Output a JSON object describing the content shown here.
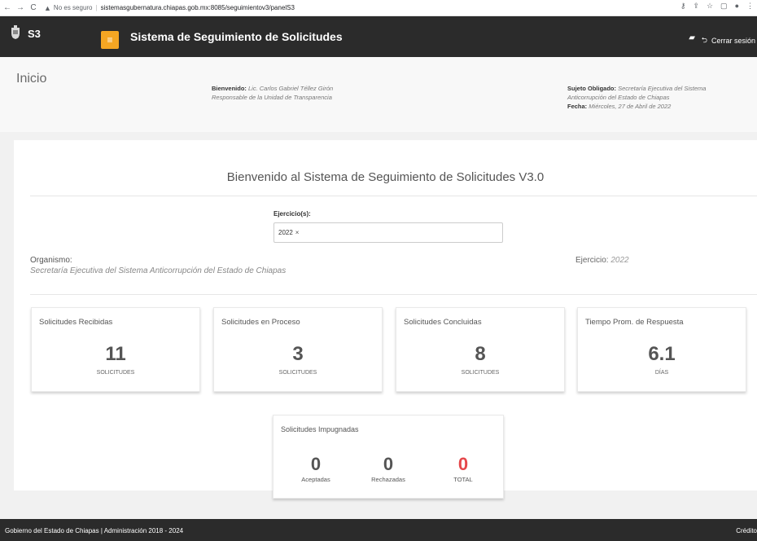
{
  "browser": {
    "back_icon": "←",
    "forward_icon": "→",
    "reload_icon": "C",
    "warning_icon": "▲",
    "security_text": "No es seguro",
    "separator": "|",
    "url": "sistemasgubernatura.chiapas.gob.mx:8085/seguimientov3/panelS3",
    "right_icons": [
      "key-icon",
      "share-icon",
      "star-icon",
      "sidebar-icon",
      "profile-icon",
      "kebab-menu-icon"
    ]
  },
  "header": {
    "short_name": "S3",
    "menu_icon": "≡",
    "title": "Sistema de Seguimiento de Solicitudes",
    "manual_icon": "▰",
    "logout_icon": "⮌",
    "logout_label": "Cerrar sesión"
  },
  "info": {
    "page_title": "Inicio",
    "welcome_label": "Bienvenido:",
    "welcome_name": "Lic. Carlos Gabriel Téllez Girón",
    "welcome_role": "Responsable de la Unidad de Transparencia",
    "obligado_label": "Sujeto Obligado:",
    "obligado_line1": "Secretaría Ejecutiva del Sistema",
    "obligado_line2": "Anticorrupción del Estado de Chiapas",
    "fecha_label": "Fecha:",
    "fecha_value": "Miércoles, 27 de Abril de 2022"
  },
  "main": {
    "hero": "Bienvenido al Sistema de Seguimiento de Solicitudes V3.0",
    "ejercicio_label": "Ejercicio(s):",
    "ejercicio_chip": "2022",
    "chip_remove": "×",
    "organismo_label": "Organismo:",
    "organismo_value": "Secretaría Ejecutiva del Sistema Anticorrupción del Estado de Chiapas",
    "ejercicio_info_label": "Ejercicio:",
    "ejercicio_info_value": "2022"
  },
  "stats": [
    {
      "title": "Solicitudes Recibidas",
      "value": "11",
      "unit": "SOLICITUDES"
    },
    {
      "title": "Solicitudes en Proceso",
      "value": "3",
      "unit": "SOLICITUDES"
    },
    {
      "title": "Solicitudes Concluidas",
      "value": "8",
      "unit": "SOLICITUDES"
    },
    {
      "title": "Tiempo Prom. de Respuesta",
      "value": "6.1",
      "unit": "DÍAS"
    }
  ],
  "impugnadas": {
    "title": "Solicitudes Impugnadas",
    "items": [
      {
        "value": "0",
        "label": "Aceptadas"
      },
      {
        "value": "0",
        "label": "Rechazadas"
      },
      {
        "value": "0",
        "label": "TOTAL"
      }
    ]
  },
  "footer": {
    "left": "Gobierno del Estado de Chiapas | Administración 2018 - 2024",
    "right": "Crédito"
  },
  "colors": {
    "header_bg": "#2b2b2b",
    "menu_button": "#f5a623",
    "total_red": "#e5474b"
  }
}
